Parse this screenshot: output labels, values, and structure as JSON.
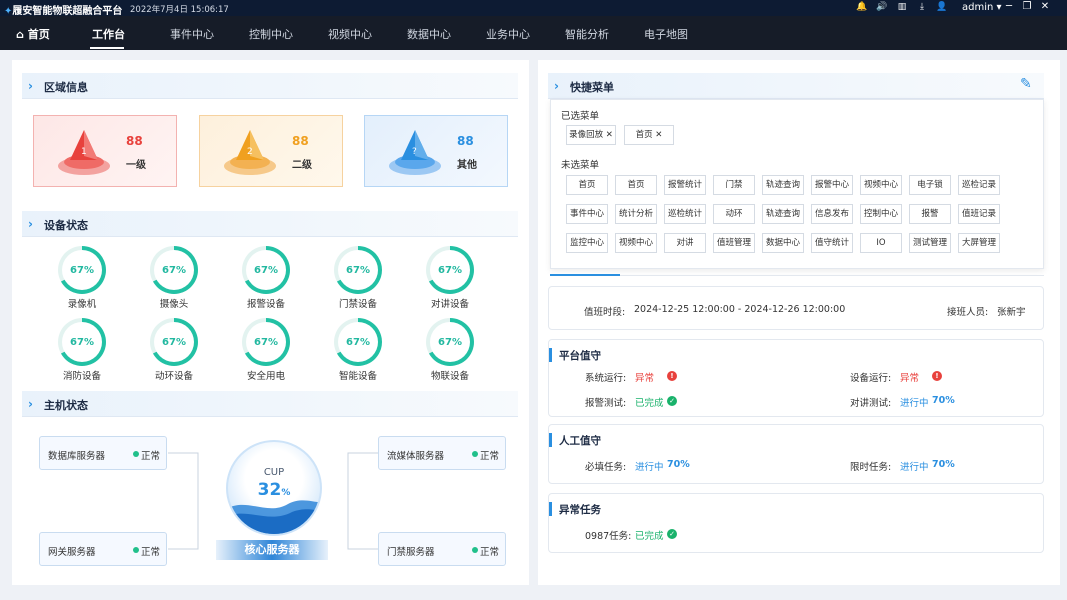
{
  "app": {
    "title": "履安智能物联超融合平台",
    "datetime": "2022年7月4日 15:06:17",
    "user": "admin"
  },
  "icons": [
    "bell-icon",
    "volume-icon",
    "chart-icon",
    "download-icon",
    "user-icon",
    "minimize-icon",
    "restore-icon",
    "close-icon"
  ],
  "nav": [
    "首页",
    "工作台",
    "事件中心",
    "控制中心",
    "视频中心",
    "数据中心",
    "业务中心",
    "智能分析",
    "电子地图"
  ],
  "region": {
    "title": "区域信息",
    "items": [
      {
        "value": "88",
        "label": "一级",
        "color": "#e8413c"
      },
      {
        "value": "88",
        "label": "二级",
        "color": "#f0a020"
      },
      {
        "value": "88",
        "label": "其他",
        "color": "#2a8fe0"
      }
    ]
  },
  "device": {
    "title": "设备状态",
    "items": [
      {
        "value": "67%",
        "label": "录像机"
      },
      {
        "value": "67%",
        "label": "摄像头"
      },
      {
        "value": "67%",
        "label": "报警设备"
      },
      {
        "value": "67%",
        "label": "门禁设备"
      },
      {
        "value": "67%",
        "label": "对讲设备"
      },
      {
        "value": "67%",
        "label": "消防设备"
      },
      {
        "value": "67%",
        "label": "动环设备"
      },
      {
        "value": "67%",
        "label": "安全用电"
      },
      {
        "value": "67%",
        "label": "智能设备"
      },
      {
        "value": "67%",
        "label": "物联设备"
      }
    ]
  },
  "host": {
    "title": "主机状态",
    "servers": [
      {
        "name": "数据库服务器",
        "status": "正常"
      },
      {
        "name": "网关服务器",
        "status": "正常"
      },
      {
        "name": "流媒体服务器",
        "status": "正常"
      },
      {
        "name": "门禁服务器",
        "status": "正常"
      }
    ],
    "cpu_label": "CUP",
    "cpu_value": "32",
    "cpu_unit": "%",
    "core_label": "核心服务器"
  },
  "quick": {
    "title": "快捷菜单",
    "selected_label": "已选菜单",
    "selected": [
      "录像回放",
      "首页"
    ],
    "unselected_label": "未选菜单",
    "unselected": [
      [
        "首页",
        "首页",
        "报警统计",
        "门禁",
        "轨迹查询",
        "报警中心",
        "视频中心",
        "电子锁",
        "巡检记录"
      ],
      [
        "事件中心",
        "统计分析",
        "巡检统计",
        "动环",
        "轨迹查询",
        "信息发布",
        "控制中心",
        "报警",
        "值班记录"
      ],
      [
        "监控中心",
        "视频中心",
        "对讲",
        "值班管理",
        "数据中心",
        "值守统计",
        "IO",
        "测试管理",
        "大屏管理"
      ]
    ]
  },
  "duty": {
    "period_label": "值班时段:",
    "period": "2024-12-25 12:00:00 - 2024-12-26 12:00:00",
    "next_label": "接班人员:",
    "next": "张新宇"
  },
  "platform": {
    "title": "平台值守",
    "sys_label": "系统运行:",
    "sys_value": "异常",
    "dev_label": "设备运行:",
    "dev_value": "异常",
    "alarm_label": "报警测试:",
    "alarm_value": "已完成",
    "talk_label": "对讲测试:",
    "talk_value": "进行中",
    "talk_pct": "70%"
  },
  "manual": {
    "title": "人工值守",
    "must_label": "必填任务:",
    "must_value": "进行中",
    "must_pct": "70%",
    "limit_label": "限时任务:",
    "limit_value": "进行中",
    "limit_pct": "70%"
  },
  "abnormal": {
    "title": "异常任务",
    "task_label": "0987任务:",
    "task_value": "已完成"
  }
}
